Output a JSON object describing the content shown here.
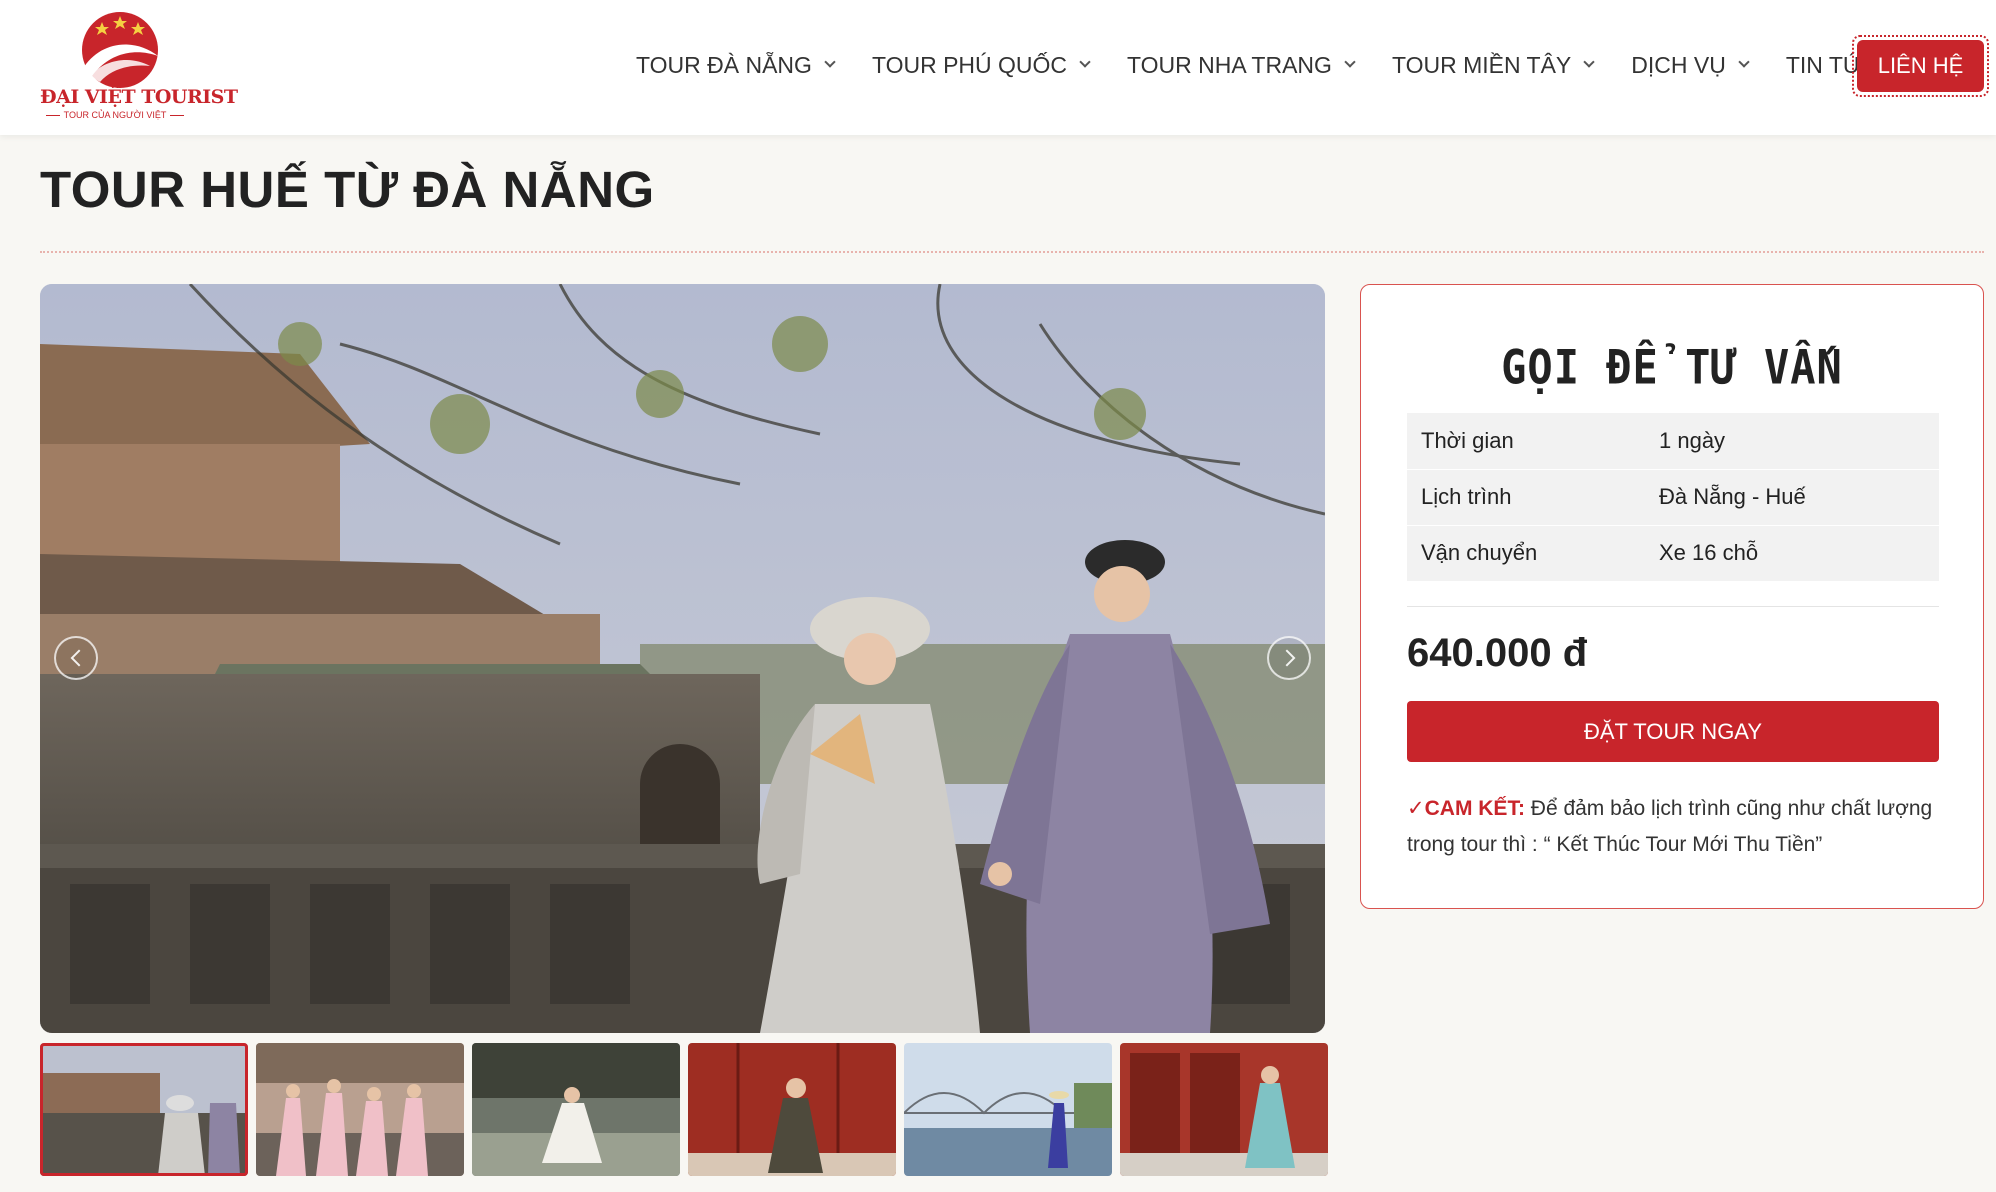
{
  "logo": {
    "brand": "ĐẠI VIỆT TOURIST",
    "slogan": "TOUR CỦA NGƯỜI VIỆT"
  },
  "nav": {
    "items": [
      {
        "label": "TOUR ĐÀ NẴNG"
      },
      {
        "label": "TOUR PHÚ QUỐC"
      },
      {
        "label": "TOUR NHA TRANG"
      },
      {
        "label": "TOUR MIỀN TÂY"
      },
      {
        "label": "DỊCH VỤ"
      },
      {
        "label": "TIN TỨC"
      }
    ],
    "contact_label": "LIÊN HỆ"
  },
  "page": {
    "title": "TOUR HUẾ TỪ ĐÀ NẴNG"
  },
  "gallery": {
    "main_image": "hue-imperial-citadel-couple-ao-dai-photo",
    "thumbnails": [
      {
        "name": "thumb-citadel-couple",
        "active": true
      },
      {
        "name": "thumb-pink-ao-dai-group",
        "active": false
      },
      {
        "name": "thumb-white-ao-dai-tomb",
        "active": false
      },
      {
        "name": "thumb-red-doors-woman",
        "active": false
      },
      {
        "name": "thumb-truong-tien-bridge",
        "active": false
      },
      {
        "name": "thumb-red-doors-blue-ao-dai",
        "active": false
      }
    ]
  },
  "booking": {
    "title": "GỌI ĐỂ TƯ VẤN",
    "rows": [
      {
        "key": "Thời gian",
        "value": "1 ngày"
      },
      {
        "key": "Lịch trình",
        "value": "Đà Nẵng - Huế"
      },
      {
        "key": "Vận chuyển",
        "value": "Xe 16 chỗ"
      }
    ],
    "price": "640.000 đ",
    "book_label": "ĐẶT TOUR NGAY",
    "commit_check": "✓",
    "commit_label": "CAM KẾT:",
    "commit_text": " Để đảm bảo lịch trình cũng như chất lượng trong tour thì : “ Kết Thúc Tour Mới Thu Tiền”"
  },
  "colors": {
    "brand_red": "#c8252b",
    "page_bg": "#f8f7f3"
  }
}
